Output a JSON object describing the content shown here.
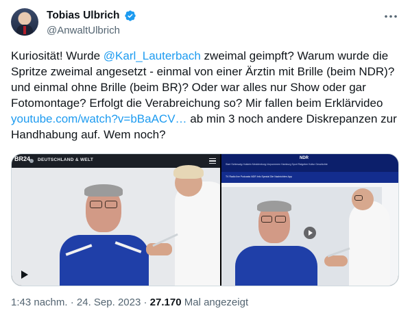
{
  "author": {
    "display_name": "Tobias Ulbrich",
    "handle": "@AnwaltUlbrich",
    "verified": true,
    "avatar_icon": "avatar"
  },
  "menu_icon": "more-dots-icon",
  "tweet": {
    "part1": "Kuriosität! Wurde ",
    "mention": "@Karl_Lauterbach",
    "part2": " zweimal geimpft? Warum wurde die Spritze zweimal angesetzt - einmal von einer Ärztin mit Brille (beim NDR)? und einmal ohne Brille (beim BR)? Oder war alles nur Show oder gar Fotomontage? Erfolgt die Verabreichung so? Mir fallen beim Erklärvideo ",
    "link": "youtube.com/watch?v=bBaACV…",
    "part3": " ab min 3 noch andere Diskrepanzen zur Handhabung auf. Wem noch?"
  },
  "media": {
    "left": {
      "channel_logo": "BR24",
      "section_title": "DEUTSCHLAND & WELT",
      "play_icon": "play-icon"
    },
    "right": {
      "channel_logo": "NDR",
      "nav": "Start   Schleswig-Holstein   Mecklenburg-Vorpommern   Hamburg   Sport   Ratgeber   Kultur   Geschichte",
      "subnav": "TV   Radio live   Podcasts   NDR Info Spezial   Die Nachrichten   App",
      "play_icon": "play-icon"
    }
  },
  "meta": {
    "time": "1:43 nachm.",
    "sep1": " · ",
    "date": "24. Sep. 2023",
    "sep2": " · ",
    "views": "27.170",
    "views_label": " Mal angezeigt"
  },
  "colors": {
    "link": "#1d9bf0",
    "verified": "#1d9bf0",
    "secondary_text": "#536471"
  }
}
